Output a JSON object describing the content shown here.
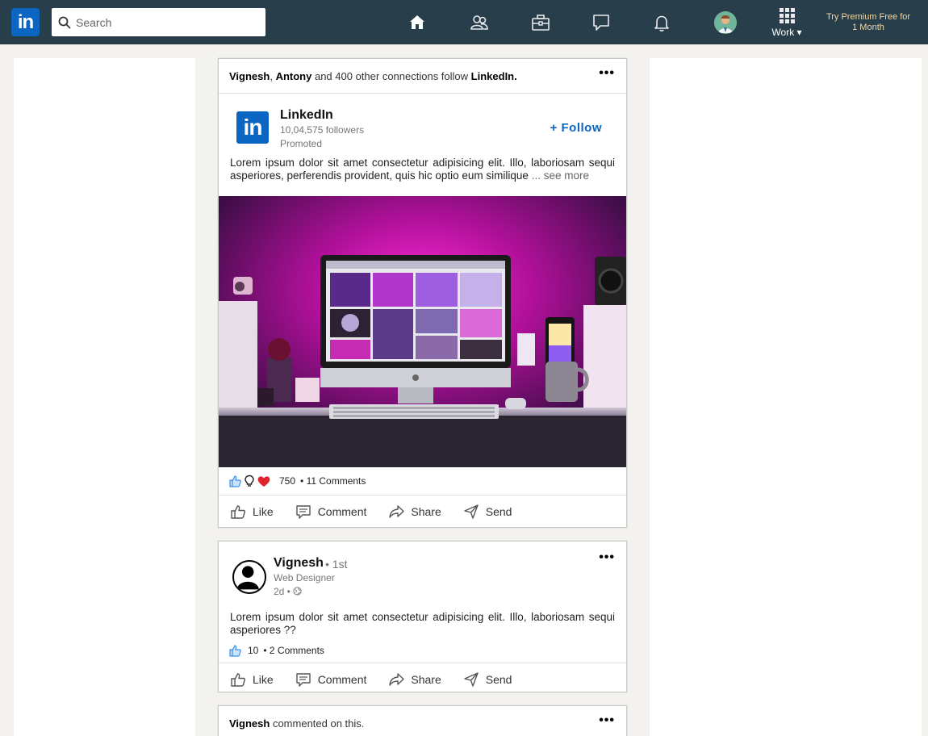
{
  "nav": {
    "logo_text": "in",
    "search_placeholder": "Search",
    "work_label": "Work ▾",
    "premium_text": "Try Premium Free for 1 Month",
    "icons": [
      "home-icon",
      "my-network-icon",
      "jobs-icon",
      "messaging-icon",
      "notifications-icon",
      "profile-avatar",
      "work-grid-icon"
    ]
  },
  "colors": {
    "nav_bg": "#283e4a",
    "brand_blue": "#0a66c2",
    "premium_gold": "#f3d7a2",
    "like_blue": "#378fe9",
    "love_red": "#e0242e"
  },
  "post1": {
    "context_names": "Vignesh",
    "context_names2": "Antony",
    "context_rest": " and 400 other connections follow ",
    "context_org": "LinkedIn.",
    "org_logo_text": "in",
    "org_name": "LinkedIn",
    "followers": "10,04,575 followers",
    "promoted": "Promoted",
    "follow_label": "+ Follow",
    "text": "Lorem ipsum dolor sit amet consectetur adipisicing elit. Illo, laboriosam sequi asperiores, perferendis provident, quis hic optio eum similique",
    "see_more": " ... see more",
    "reactions_count": "750",
    "comments": "• 11 Comments"
  },
  "post2": {
    "name": "Vignesh",
    "degree": "• 1st",
    "title": "Web Designer",
    "time": "2d •",
    "text": "Lorem ipsum dolor sit amet consectetur adipisicing elit. Illo, laboriosam sequi asperiores ??",
    "reactions_count": "10",
    "comments": "• 2 Comments"
  },
  "post3": {
    "context_name": "Vignesh",
    "context_rest": " commented on this."
  },
  "actions": {
    "like": "Like",
    "comment": "Comment",
    "share": "Share",
    "send": "Send"
  }
}
